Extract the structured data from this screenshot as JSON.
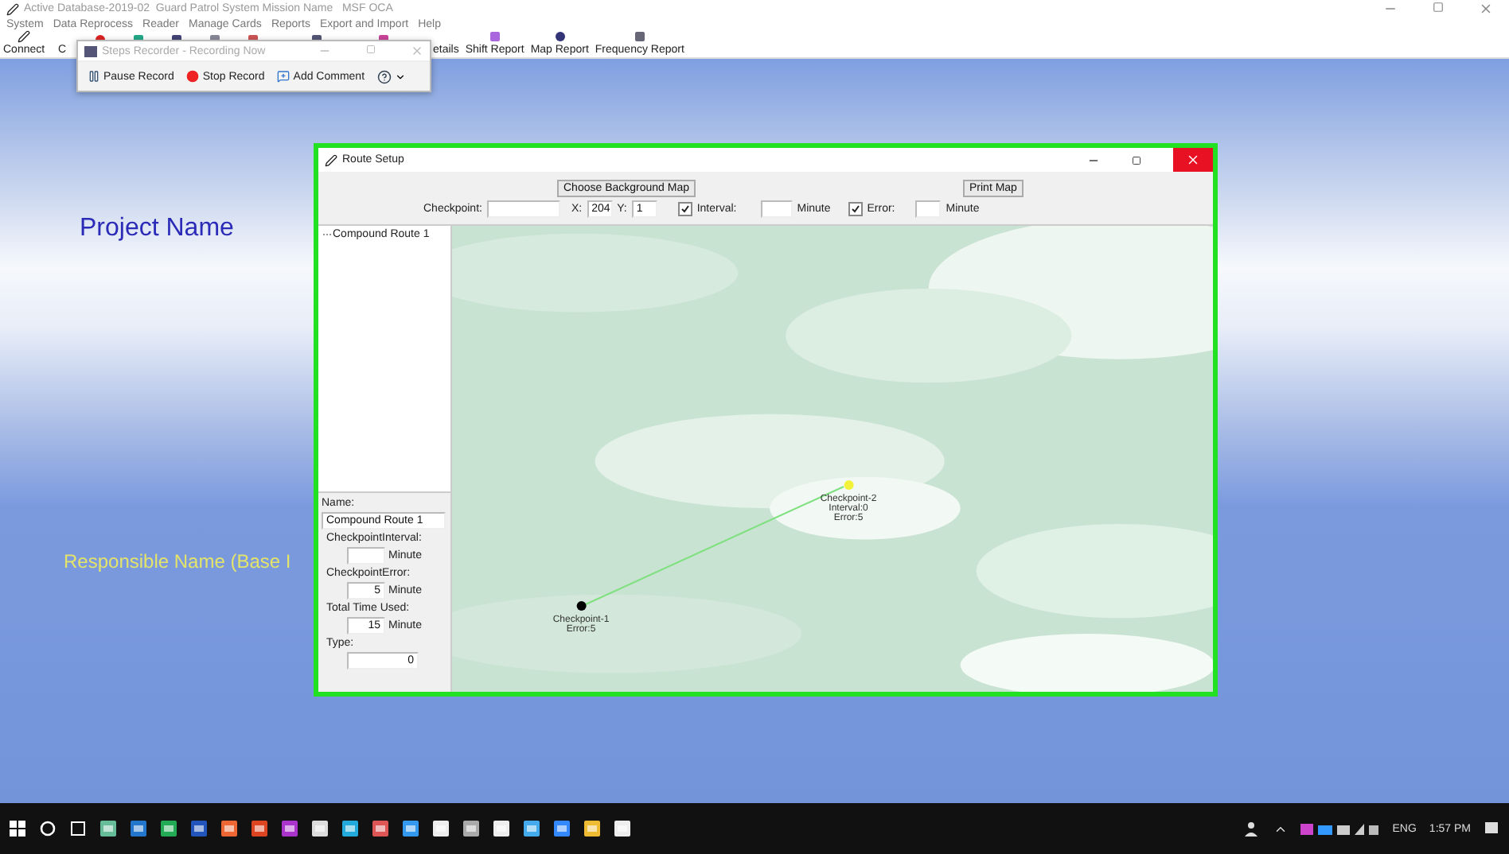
{
  "app_window": {
    "title": "Active Database-2019-02  Guard Patrol System Mission Name   MSF OCA"
  },
  "menu": [
    "System",
    "Data Reprocess",
    "Reader",
    "Manage Cards",
    "Reports",
    "Export and Import",
    "Help"
  ],
  "toolbar": {
    "left_items": [
      "Connect",
      "C"
    ],
    "right_items": [
      "etails",
      "Shift Report",
      "Map Report",
      "Frequency Report"
    ]
  },
  "steps_recorder": {
    "title": "Steps Recorder - Recording Now",
    "buttons": [
      "Pause Record",
      "Stop Record",
      "Add Comment"
    ]
  },
  "background": {
    "project_name": "Project Name",
    "responsible_name": "Responsible Name (Base I"
  },
  "route_setup": {
    "title": "Route Setup",
    "choose_map_button": "Choose Background Map",
    "print_button": "Print Map",
    "checkpoint_label": "Checkpoint:",
    "x_label": "X:",
    "x_value": "204",
    "y_label": "Y:",
    "y_value": "1",
    "interval": {
      "label": "Interval:",
      "checked": true,
      "unit": "Minute"
    },
    "error": {
      "label": "Error:",
      "checked": true,
      "unit": "Minute"
    },
    "tree": [
      {
        "label": "Compound Route 1"
      }
    ],
    "form": {
      "name_label": "Name:",
      "name_value": "Compound Route 1",
      "fields": [
        {
          "label": "CheckpointInterval:",
          "unit": "Minute"
        },
        {
          "label": "CheckpointError:",
          "value": "5",
          "unit": "Minute"
        },
        {
          "label": "Total Time Used:",
          "value": "15",
          "unit": "Minute"
        },
        {
          "label": "Type:",
          "value": "0"
        }
      ]
    },
    "map": {
      "checkpoints": [
        {
          "lines": [
            "Checkpoint-1",
            "Error:5"
          ],
          "color": "#000000"
        },
        {
          "lines": [
            "Checkpoint-2",
            "Interval:0",
            "Error:5"
          ],
          "color": "#f2f23a"
        }
      ]
    }
  },
  "taskbar": {
    "language": "ENG",
    "time": "1:57 PM"
  }
}
